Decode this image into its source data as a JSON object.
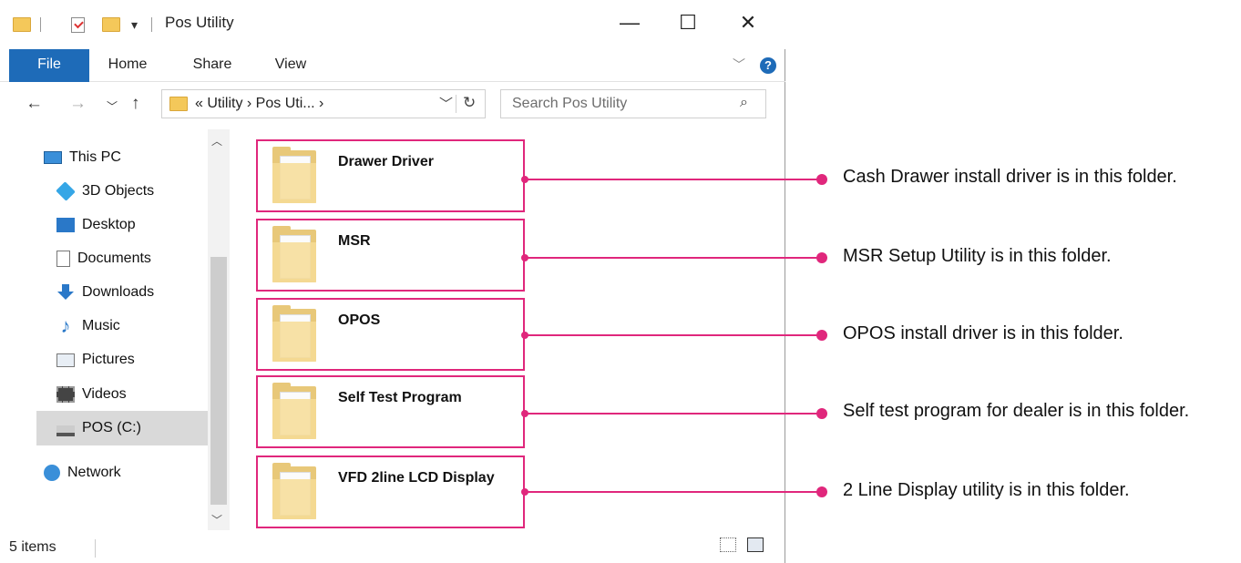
{
  "window": {
    "title": "Pos Utility",
    "controls": {
      "minimize": "—",
      "maximize": "☐",
      "close": "✕"
    }
  },
  "ribbon": {
    "tabs": [
      "File",
      "Home",
      "Share",
      "View"
    ],
    "help": "?"
  },
  "address": {
    "path": "« Utility › Pos Uti... ›",
    "search_placeholder": "Search Pos Utility"
  },
  "nav": {
    "items": [
      {
        "label": "This PC",
        "icon": "computer-icon"
      },
      {
        "label": "3D Objects",
        "icon": "cube-icon"
      },
      {
        "label": "Desktop",
        "icon": "desktop-icon"
      },
      {
        "label": "Documents",
        "icon": "document-icon"
      },
      {
        "label": "Downloads",
        "icon": "download-icon"
      },
      {
        "label": "Music",
        "icon": "music-icon"
      },
      {
        "label": "Pictures",
        "icon": "pictures-icon"
      },
      {
        "label": "Videos",
        "icon": "video-icon"
      },
      {
        "label": "POS (C:)",
        "icon": "drive-icon",
        "selected": true
      },
      {
        "label": "Network",
        "icon": "network-icon"
      }
    ]
  },
  "files": [
    {
      "name": "Drawer Driver",
      "note": "Cash Drawer install driver is in this folder."
    },
    {
      "name": "MSR",
      "note": "MSR Setup Utility is in this folder."
    },
    {
      "name": "OPOS",
      "note": "OPOS install driver is in this folder."
    },
    {
      "name": "Self Test Program",
      "note": "Self test program for dealer is in this folder."
    },
    {
      "name": "VFD 2line LCD Display",
      "note": "2 Line Display utility is in this folder."
    }
  ],
  "status": {
    "count": "5 items"
  },
  "colors": {
    "accent": "#1e6bb8",
    "highlight": "#e0277c",
    "folder": "#e8c879"
  }
}
